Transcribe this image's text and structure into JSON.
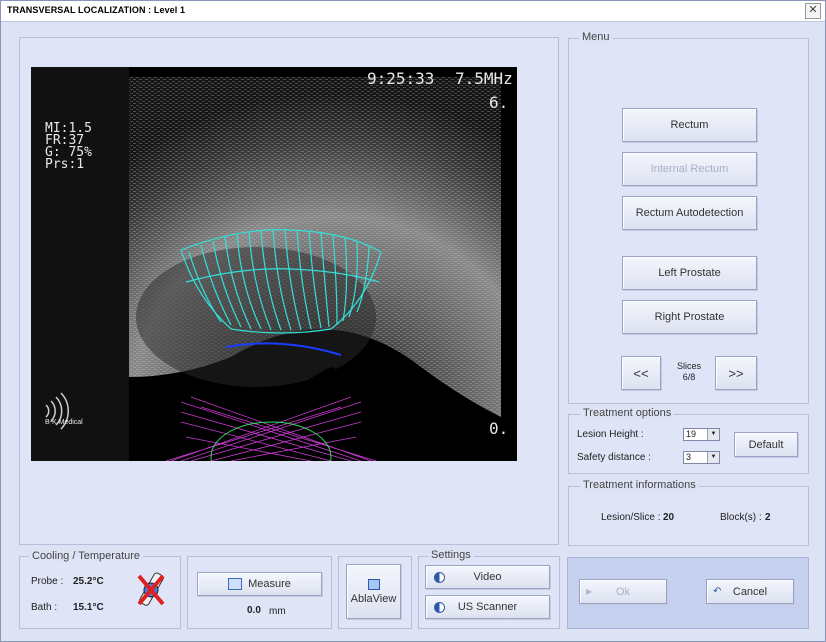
{
  "window": {
    "title": "TRANSVERSAL LOCALIZATION   : Level 1",
    "close_glyph": "✕"
  },
  "ultrasound": {
    "time": "9:25:33",
    "frequency": "7.5MHz",
    "depth_top": "6.",
    "depth_bottom": "0.",
    "params": [
      "MI:1.5",
      "FR:37",
      "G: 75%",
      "Prs:1"
    ],
    "brand": "B-K Medical"
  },
  "menu": {
    "label": "Menu",
    "rectum": "Rectum",
    "internal_rectum": "Internal Rectum",
    "rectum_autodetection": "Rectum Autodetection",
    "left_prostate": "Left Prostate",
    "right_prostate": "Right Prostate",
    "prev": "<<",
    "next": ">>",
    "slices_label": "Slices",
    "slices_value": "6/8"
  },
  "treatment_options": {
    "label": "Treatment options",
    "lesion_height_label": "Lesion Height :",
    "lesion_height_value": "19",
    "safety_distance_label": "Safety distance :",
    "safety_distance_value": "3",
    "default_button": "Default"
  },
  "treatment_info": {
    "label": "Treatment informations",
    "lesion_slice_label": "Lesion/Slice :",
    "lesion_slice_value": "20",
    "blocks_label": "Block(s) :",
    "blocks_value": "2"
  },
  "cooling": {
    "label": "Cooling / Temperature",
    "probe_label": "Probe :",
    "probe_value": "25.2°C",
    "bath_label": "Bath :",
    "bath_value": "15.1°C"
  },
  "measure": {
    "button": "Measure",
    "value": "0.0",
    "unit": "mm"
  },
  "ablaview": {
    "button": "AblaView"
  },
  "settings": {
    "label": "Settings",
    "video": "Video",
    "us_scanner": "US Scanner"
  },
  "dialog": {
    "ok": "Ok",
    "cancel": "Cancel"
  },
  "colors": {
    "contour": "#33e0d8",
    "probe_lines": "#e040e8",
    "rectum_line": "#1a3cff",
    "window_bg": "#dde3f5"
  }
}
